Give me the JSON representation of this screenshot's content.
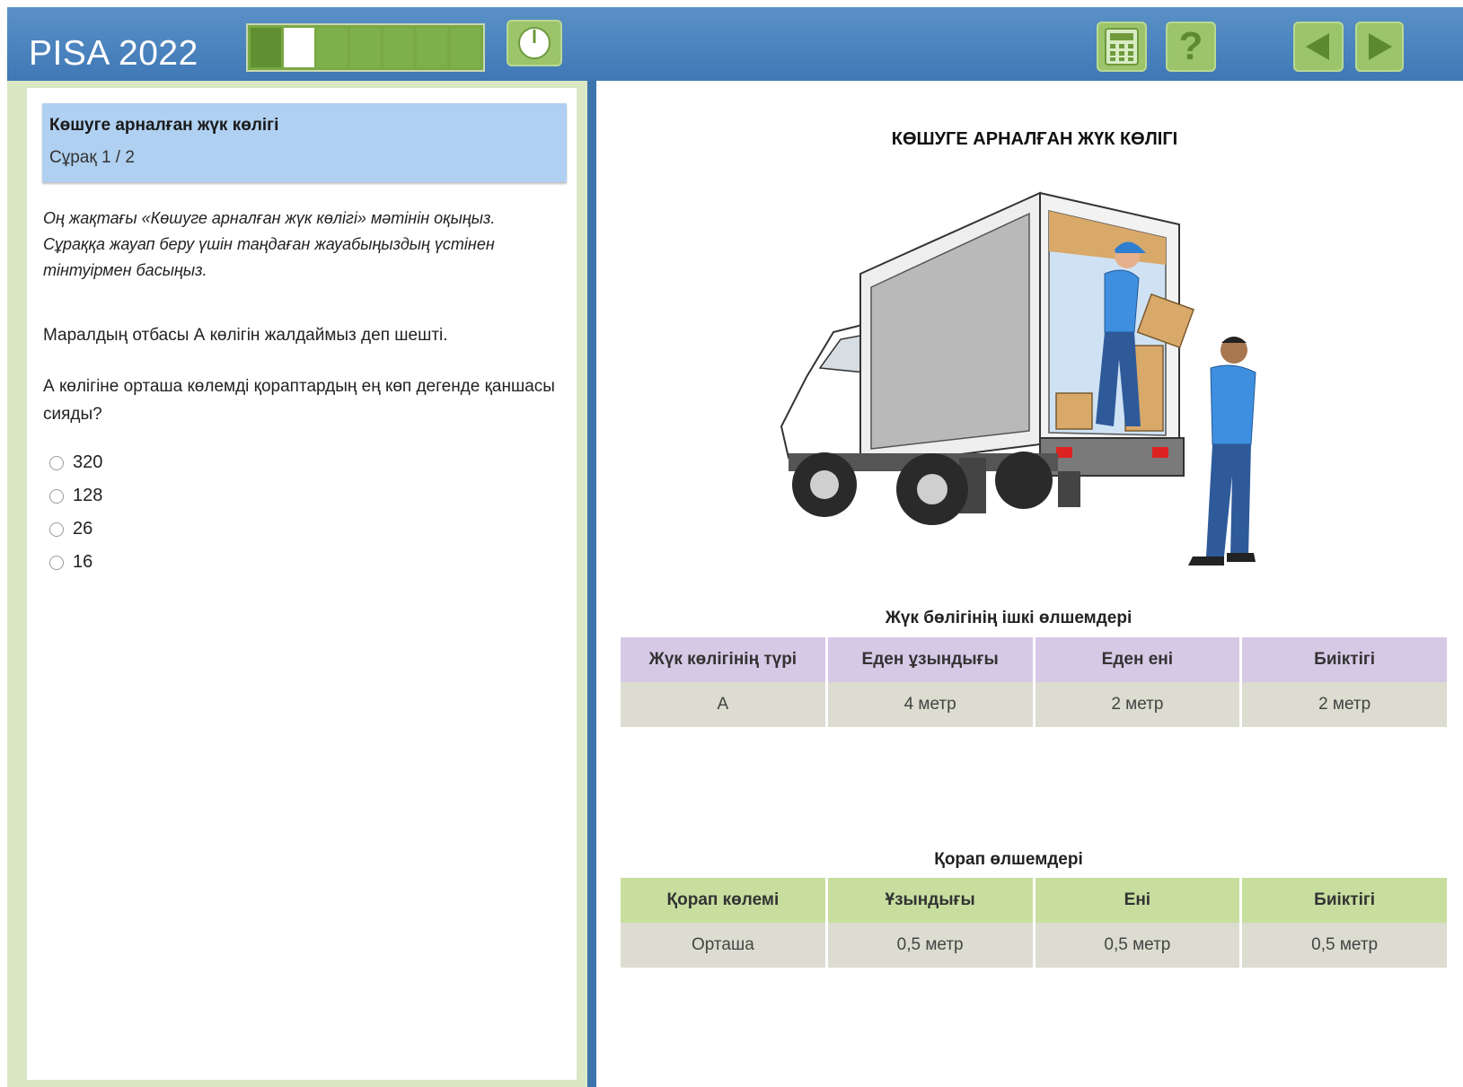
{
  "app": {
    "title": "PISA 2022"
  },
  "progress": {
    "current": 2,
    "total": 7
  },
  "toolbar": {
    "icons": [
      "clock-icon",
      "calculator-icon",
      "help-icon",
      "back-arrow-icon",
      "next-arrow-icon"
    ],
    "help_glyph": "?"
  },
  "question": {
    "unit_title": "Көшуге арналған жүк көлігі",
    "counter": "Сұрақ 1 / 2",
    "instruction": "Оң жақтағы «Көшуге арналған жүк көлігі» мәтінін оқыңыз. Сұраққа жауап беру үшін таңдаған жауабыңыздың үстінен тінтуірмен басыңыз.",
    "stem_1": "Маралдың отбасы А көлігін жалдаймыз деп шешті.",
    "stem_2": "А көлігіне орташа көлемді қораптардың ең көп дегенде қаншасы сияды?",
    "options": [
      "320",
      "128",
      "26",
      "16"
    ]
  },
  "document": {
    "title": "КӨШУГЕ АРНАЛҒАН ЖҮК КӨЛІГІ",
    "table1": {
      "caption": "Жүк бөлігінің ішкі өлшемдері",
      "headers": [
        "Жүк көлігінің түрі",
        "Еден ұзындығы",
        "Еден ені",
        "Биіктігі"
      ],
      "row": [
        "А",
        "4 метр",
        "2 метр",
        "2 метр"
      ]
    },
    "table2": {
      "caption": "Қорап өлшемдері",
      "headers": [
        "Қорап көлемі",
        "Ұзындығы",
        "Ені",
        "Биіктігі"
      ],
      "row": [
        "Орташа",
        "0,5 метр",
        "0,5 метр",
        "0,5 метр"
      ]
    }
  },
  "colors": {
    "topbar": "#4a84c0",
    "button": "#9bc46b",
    "left_border": "#d9e7c4",
    "header_box": "#afd0f0",
    "table1_header": "#d6c9e6",
    "table2_header": "#c7de9f",
    "cells": "#dcdcd0"
  }
}
